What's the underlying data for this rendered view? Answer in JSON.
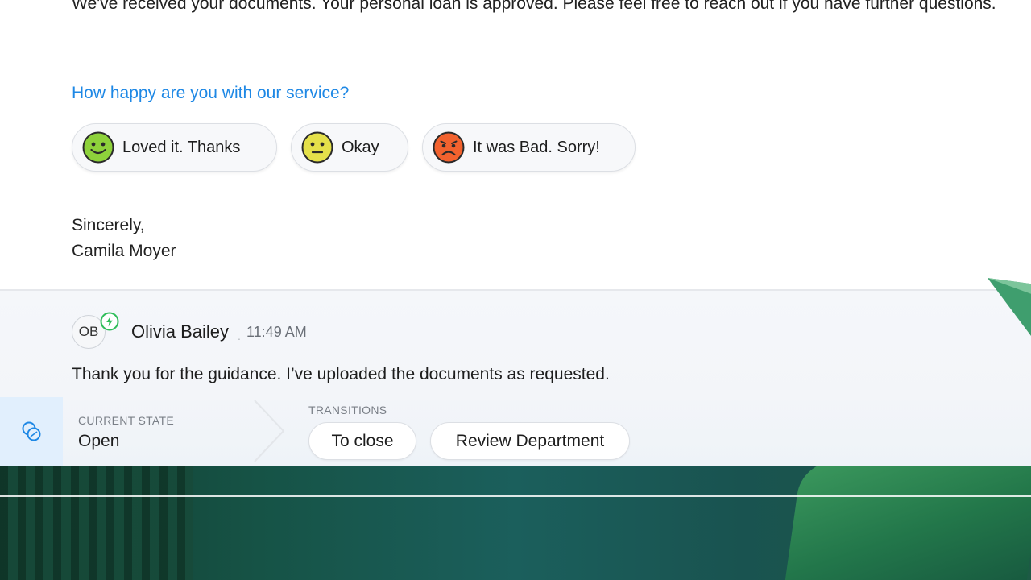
{
  "message": {
    "intro": "We've received your documents. Your personal loan is approved. Please feel free to reach out if you have further questions.",
    "rating_question": "How happy are you with our service?",
    "rating_options": [
      {
        "label": "Loved it. Thanks",
        "face": "happy-face-icon",
        "color": "#8ed23b"
      },
      {
        "label": "Okay",
        "face": "neutral-face-icon",
        "color": "#e4e04a"
      },
      {
        "label": "It was Bad. Sorry!",
        "face": "sad-face-icon",
        "color": "#f2622e"
      }
    ],
    "signoff_line1": "Sincerely,",
    "signoff_line2": "Camila Moyer"
  },
  "reply": {
    "avatar_initials": "OB",
    "badge_icon": "lightning-badge-icon",
    "sender": "Olivia Bailey",
    "time": "11:49 AM",
    "text": "Thank you for the guidance. I’ve uploaded the documents as requested."
  },
  "state": {
    "icon": "coins-icon",
    "current_label": "CURRENT STATE",
    "current_value": "Open",
    "transitions_label": "TRANSITIONS",
    "transitions": [
      "To close",
      "Review Department"
    ]
  },
  "colors": {
    "link_blue": "#1e88e5",
    "badge_green": "#2ebd59",
    "state_tab_bg": "#e1effd"
  }
}
